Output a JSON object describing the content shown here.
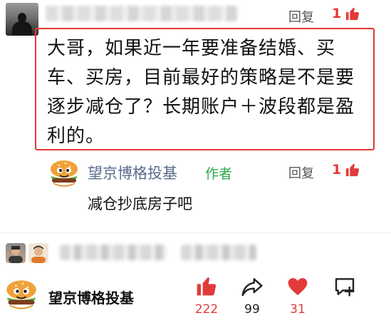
{
  "top_comment": {
    "reply_label": "回复",
    "like_count": "1",
    "question_lines": [
      "大哥，如果近一年要准备结婚、买",
      "车、买房，目前最好的策略是不是要",
      "逐步减仓了？长期账户＋波段都是盈",
      "利的。"
    ]
  },
  "author_reply": {
    "name": "望京博格投基",
    "tag": "作者",
    "reply_label": "回复",
    "like_count": "1",
    "text": "减仓抄底房子吧"
  },
  "bottom_bar": {
    "name": "望京博格投基",
    "like_count": "222",
    "share_count": "99",
    "heart_count": "31"
  },
  "colors": {
    "accent_red": "#e23a3a",
    "box_border": "#e53935",
    "author_name": "#5b6b8c",
    "author_tag": "#2aa84a"
  }
}
